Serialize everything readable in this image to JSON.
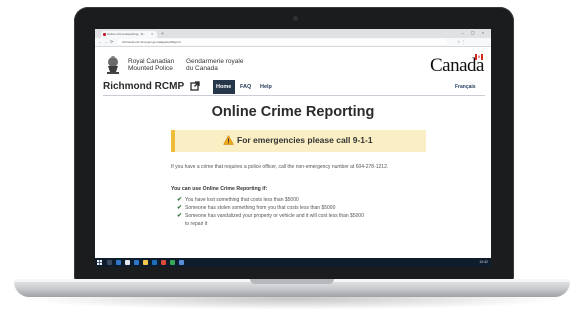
{
  "browser": {
    "tab_title": "Online Crime Reporting - R...",
    "tab_close": "×",
    "new_tab": "+",
    "window_controls": "– ▢ ×",
    "back": "←",
    "forward": "→",
    "reload": "⟳",
    "url": "richmond.ocr.rcmp-grc.gc.ca/app/ocr/Report",
    "extensions": "☆ ⋮"
  },
  "header": {
    "org_name_en": "Royal Canadian\nMounted Police",
    "org_name_fr": "Gendarmerie royale\ndu Canada",
    "wordmark": "Canada",
    "site_title": "Richmond RCMP",
    "language_toggle": "Français"
  },
  "menu": [
    {
      "label": "Home",
      "active": true
    },
    {
      "label": "FAQ",
      "active": false
    },
    {
      "label": "Help",
      "active": false
    }
  ],
  "main": {
    "title": "Online Crime Reporting",
    "alert": "For emergencies please call 9-1-1",
    "intro": "If you have a crime that requires a police officer, call the non-emergency number at 604-278-1212.",
    "lead": "You can use Online Crime Reporting if:",
    "criteria": [
      "You have lost something that costs less than $5000",
      "Someone has stolen something from you that costs less than $5000",
      "Someone has vandalized your property or vehicle and it will cost less than $5000",
      "to repair it"
    ]
  },
  "taskbar": {
    "clock": "10:42"
  },
  "colors": {
    "menu_active_bg": "#26374a",
    "alert_bg": "#faefc4",
    "alert_border": "#f0bd3a",
    "title_underline": "#af3c43",
    "taskbar_bg": "#0f1c2b",
    "check_color": "#2a6e2e"
  },
  "icons": {
    "fip": "rcmp-crest-icon",
    "external": "external-link-icon",
    "alert": "warning-triangle-icon",
    "check": "check-icon",
    "start": "windows-start-icon"
  }
}
